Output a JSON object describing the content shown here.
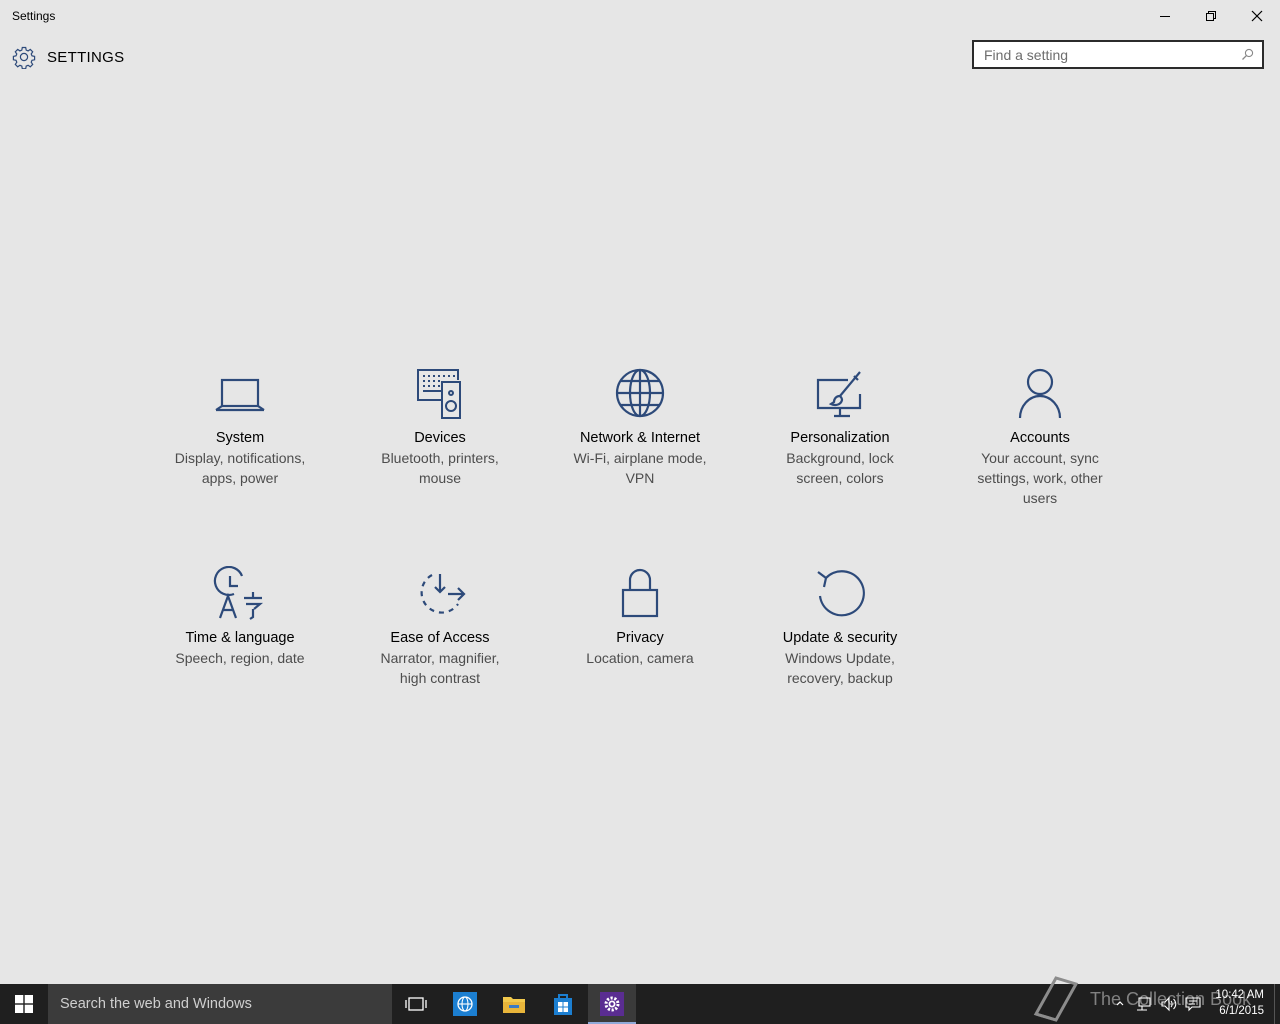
{
  "window": {
    "title": "Settings",
    "minimize_icon": "minimize-icon",
    "maximize_icon": "restore-icon",
    "close_icon": "close-icon"
  },
  "header": {
    "icon": "gear-icon",
    "title": "SETTINGS"
  },
  "search": {
    "placeholder": "Find a setting",
    "value": "",
    "icon": "search-icon"
  },
  "categories": [
    {
      "name": "System",
      "description": "Display, notifications, apps, power",
      "icon": "laptop-icon"
    },
    {
      "name": "Devices",
      "description": "Bluetooth, printers, mouse",
      "icon": "devices-icon"
    },
    {
      "name": "Network & Internet",
      "description": "Wi-Fi, airplane mode, VPN",
      "icon": "globe-icon"
    },
    {
      "name": "Personalization",
      "description": "Background, lock screen, colors",
      "icon": "paintbrush-icon"
    },
    {
      "name": "Accounts",
      "description": "Your account, sync settings, work, other users",
      "icon": "person-icon"
    },
    {
      "name": "Time & language",
      "description": "Speech, region, date",
      "icon": "time-language-icon"
    },
    {
      "name": "Ease of Access",
      "description": "Narrator, magnifier, high contrast",
      "icon": "ease-of-access-icon"
    },
    {
      "name": "Privacy",
      "description": "Location, camera",
      "icon": "lock-icon"
    },
    {
      "name": "Update & security",
      "description": "Windows Update, recovery, backup",
      "icon": "refresh-icon"
    }
  ],
  "taskbar": {
    "search_placeholder": "Search the web and Windows",
    "watermark": "The Collection Book",
    "clock": {
      "time": "10:42 AM",
      "date": "6/1/2015"
    }
  },
  "colors": {
    "background": "#e6e6e6",
    "icon_accent": "#2d4a7a",
    "taskbar": "#1f1f1f"
  }
}
